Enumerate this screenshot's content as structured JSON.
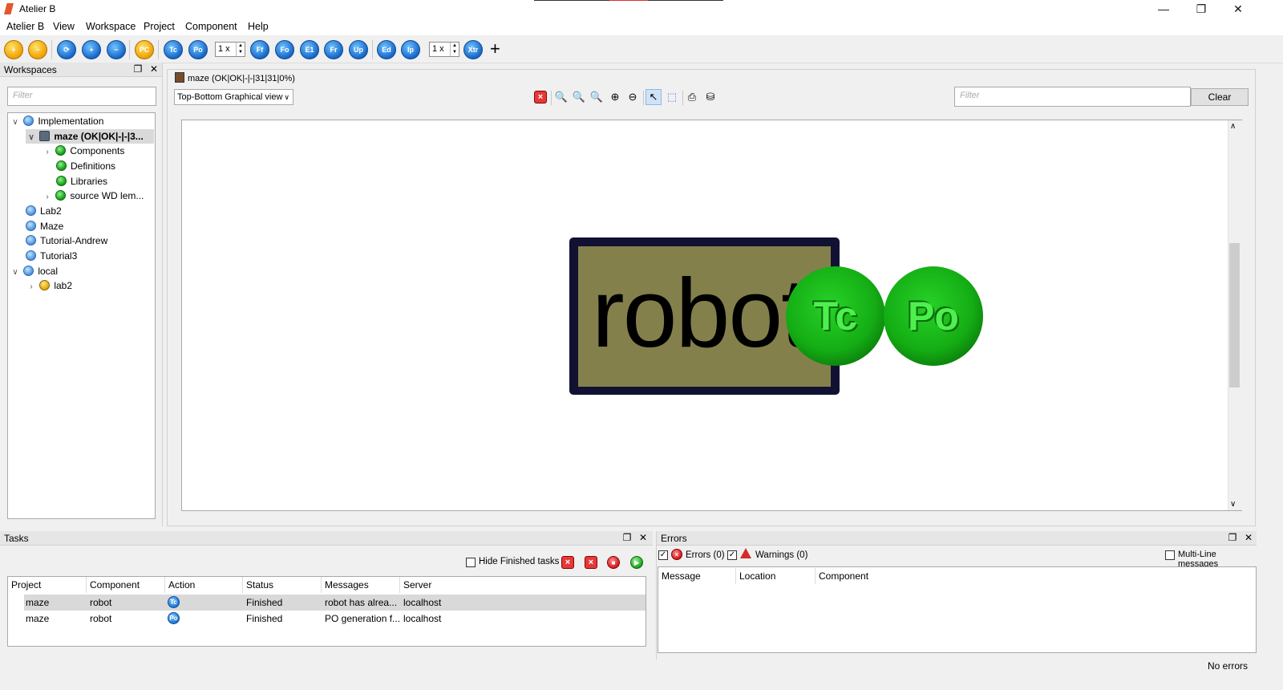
{
  "app": {
    "title": "Atelier B",
    "window_controls": {
      "minimize": "—",
      "restore": "❐",
      "close": "✕"
    }
  },
  "menu": [
    {
      "label": "Atelier B"
    },
    {
      "label": "View"
    },
    {
      "label": "Workspace"
    },
    {
      "label": "Project"
    },
    {
      "label": "Component"
    },
    {
      "label": "Help"
    }
  ],
  "toolbar": {
    "buttons": [
      "Tc",
      "Po",
      "Ff",
      "Fo",
      "E1",
      "Fr",
      "Up",
      "Ed",
      "Ip",
      "Xtr"
    ],
    "spin1": "1 x",
    "spin2": "1 x",
    "add": "+"
  },
  "workspaces": {
    "title": "Workspaces",
    "filter_placeholder": "Filter",
    "tree": [
      {
        "label": "Implementation",
        "icon": "workspace-icon"
      },
      {
        "label": "maze (OK|OK|-|-|3...",
        "icon": "project-icon"
      },
      {
        "label": "Components",
        "icon": "components-icon"
      },
      {
        "label": "Definitions",
        "icon": "definitions-icon"
      },
      {
        "label": "Libraries",
        "icon": "libraries-icon"
      },
      {
        "label": "source WD lem...",
        "icon": "source-icon"
      },
      {
        "label": "Lab2",
        "icon": "workspace-icon"
      },
      {
        "label": "Maze",
        "icon": "workspace-icon"
      },
      {
        "label": "Tutorial-Andrew",
        "icon": "workspace-icon"
      },
      {
        "label": "Tutorial3",
        "icon": "workspace-icon"
      },
      {
        "label": "local",
        "icon": "workspace-icon"
      },
      {
        "label": "lab2",
        "icon": "project-icon"
      }
    ]
  },
  "editor": {
    "tab_title": "maze (OK|OK|-|-|31|31|0%)",
    "view_mode": "Top-Bottom Graphical view",
    "filter_placeholder": "Filter",
    "clear_label": "Clear",
    "component_name": "robot",
    "badges": [
      "Tc",
      "Po"
    ]
  },
  "tasks": {
    "title": "Tasks",
    "hide_finished_label": "Hide Finished tasks",
    "columns": [
      "Project",
      "Component",
      "Action",
      "Status",
      "Messages",
      "Server"
    ],
    "rows": [
      {
        "project": "maze",
        "component": "robot",
        "action": "Tc",
        "status": "Finished",
        "message": "robot has alrea...",
        "server": "localhost"
      },
      {
        "project": "maze",
        "component": "robot",
        "action": "Po",
        "status": "Finished",
        "message": "PO generation f...",
        "server": "localhost"
      }
    ]
  },
  "errors": {
    "title": "Errors",
    "errors_label": "Errors (0)",
    "warnings_label": "Warnings (0)",
    "multiline_label": "Multi-Line messages",
    "columns": [
      "Message",
      "Location",
      "Component"
    ]
  },
  "status": {
    "text": "No errors"
  },
  "colors": {
    "robot_fill": "#84804c",
    "robot_border": "#111133",
    "badge_green": "#14ad14"
  }
}
